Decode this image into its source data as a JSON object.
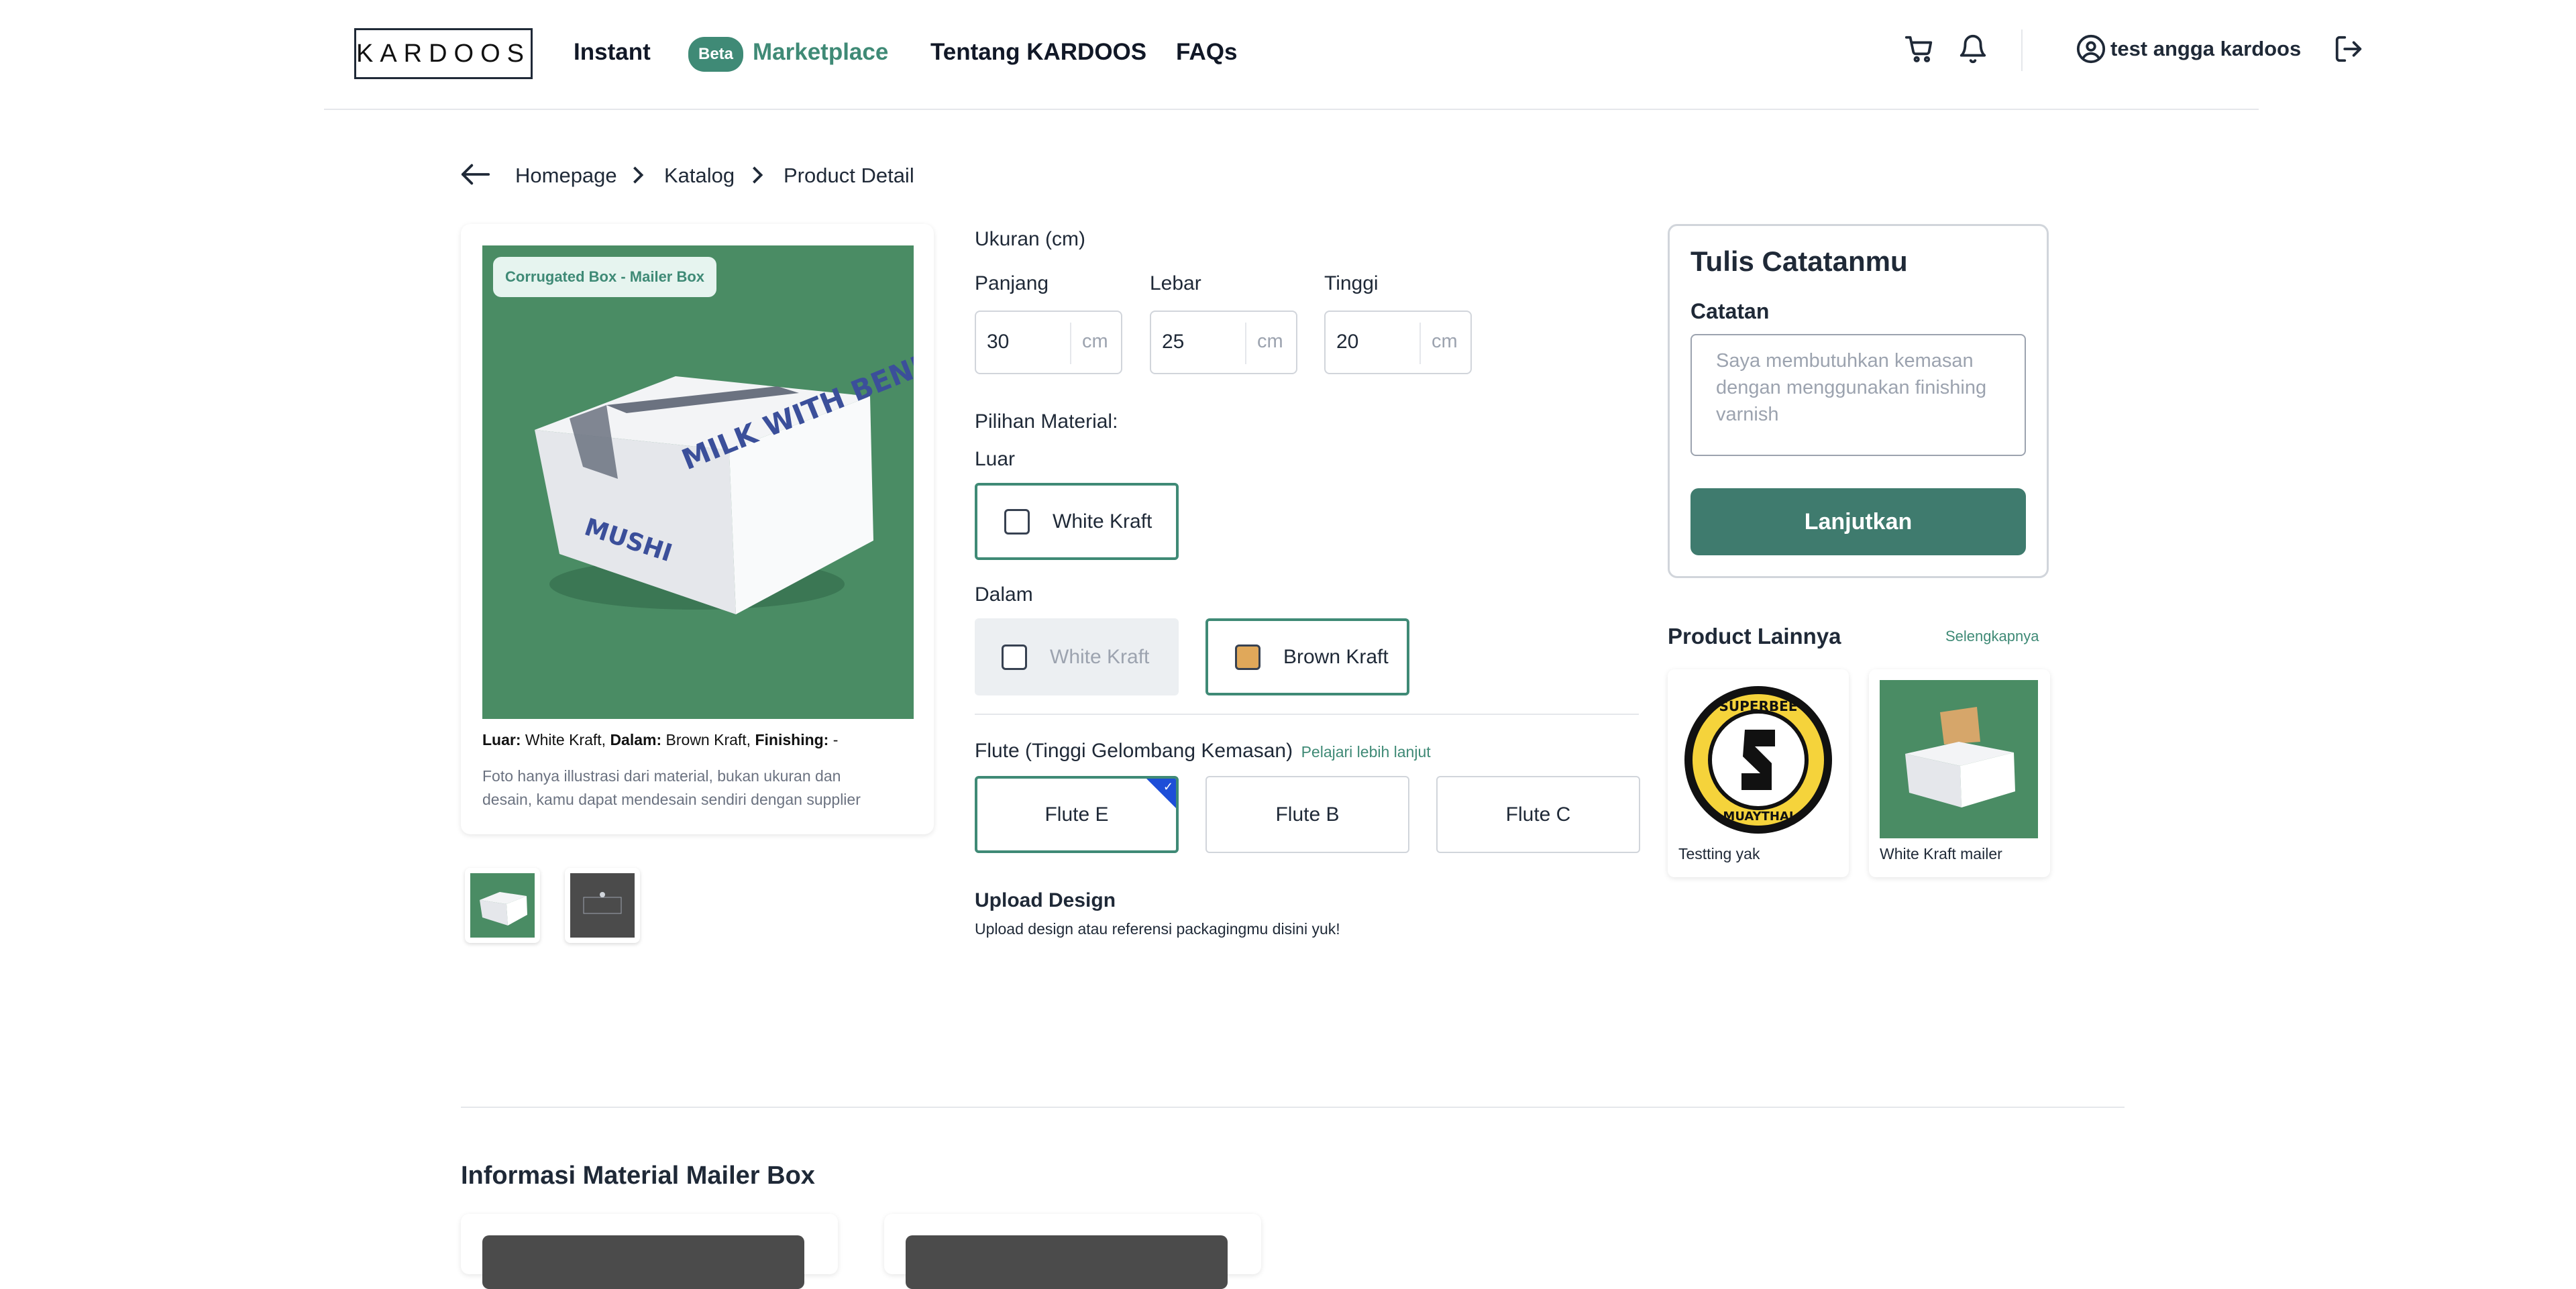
{
  "header": {
    "logo": "KARDOOS",
    "nav": {
      "instant": "Instant",
      "beta": "Beta",
      "marketplace": "Marketplace",
      "tentang": "Tentang KARDOOS",
      "faqs": "FAQs"
    },
    "user_name": "test angga kardoos",
    "icons": [
      "cart-icon",
      "bell-icon",
      "user-circle-icon",
      "logout-icon"
    ]
  },
  "breadcrumb": {
    "items": [
      "Homepage",
      "Katalog",
      "Product Detail"
    ]
  },
  "product": {
    "category_badge": "Corrugated Box - Mailer Box",
    "box_text_main": "MILK WITH BENEFITS",
    "box_text_side": "MUSHI",
    "spec": {
      "luar_label": "Luar:",
      "luar_value": "White Kraft,",
      "dalam_label": "Dalam:",
      "dalam_value": "Brown Kraft,",
      "finishing_label": "Finishing:",
      "finishing_value": "-"
    },
    "note_line1": "Foto hanya illustrasi dari material, bukan ukuran dan",
    "note_line2": "desain, kamu dapat mendesain sendiri dengan supplier"
  },
  "size": {
    "title": "Ukuran (cm)",
    "fields": [
      {
        "label": "Panjang",
        "value": "30",
        "unit": "cm"
      },
      {
        "label": "Lebar",
        "value": "25",
        "unit": "cm"
      },
      {
        "label": "Tinggi",
        "value": "20",
        "unit": "cm"
      }
    ]
  },
  "material": {
    "title": "Pilihan Material:",
    "luar_title": "Luar",
    "luar_options": [
      "White Kraft"
    ],
    "dalam_title": "Dalam",
    "dalam_options": [
      "White Kraft",
      "Brown Kraft"
    ]
  },
  "flute": {
    "title": "Flute (Tinggi Gelombang Kemasan)",
    "learn_more": "Pelajari lebih lanjut",
    "options": [
      "Flute E",
      "Flute B",
      "Flute C"
    ],
    "selected": "Flute E"
  },
  "upload": {
    "title": "Upload Design",
    "subtitle": "Upload design atau referensi packagingmu disini yuk!"
  },
  "notes_panel": {
    "title": "Tulis Catatanmu",
    "label": "Catatan",
    "placeholder": "Saya membutuhkan kemasan dengan menggunakan finishing varnish",
    "button": "Lanjutkan"
  },
  "other_products": {
    "title": "Product Lainnya",
    "see_more": "Selengkapnya",
    "items": [
      {
        "name": "Testting yak",
        "logo_top": "SUPERBEE",
        "logo_bottom": "MUAYTHAI"
      },
      {
        "name": "White Kraft mailer"
      }
    ]
  },
  "info": {
    "title": "Informasi Material Mailer Box"
  },
  "colors": {
    "brand_green": "#3f8a76",
    "button_green": "#3f7b6e",
    "product_bg": "#4a8c64",
    "brown_kraft": "#e0a85a",
    "flute_corner": "#1d4ed8"
  }
}
